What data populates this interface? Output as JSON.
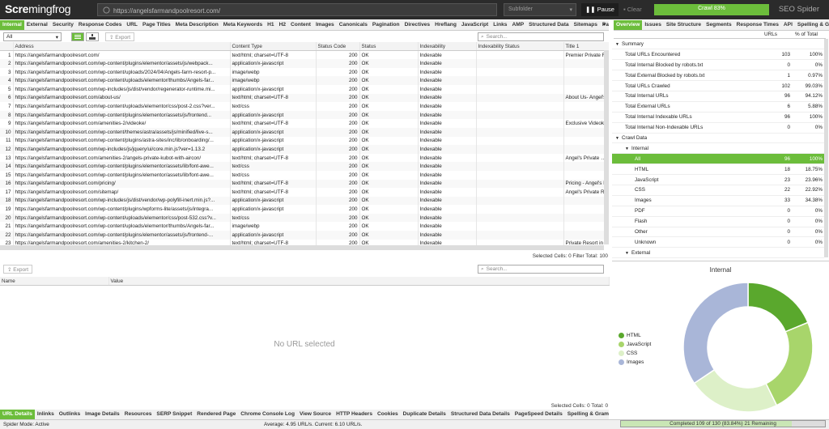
{
  "app": {
    "logo_left": "Scre",
    "logo_frog": "mingfrog",
    "brand": "SEO Spider"
  },
  "toolbar": {
    "url": "https://angelsfarmandpoolresort.com/",
    "subfolder": "Subfolder",
    "pause": "Pause",
    "clear": "Clear",
    "crawl_label": "Crawl 83%",
    "crawl_progress": 0.83
  },
  "main_tabs": [
    "Internal",
    "External",
    "Security",
    "Response Codes",
    "URL",
    "Page Titles",
    "Meta Description",
    "Meta Keywords",
    "H1",
    "H2",
    "Content",
    "Images",
    "Canonicals",
    "Pagination",
    "Directives",
    "Hreflang",
    "JavaScript",
    "Links",
    "AMP",
    "Structured Data",
    "Sitemaps",
    "PageSpee"
  ],
  "filter": {
    "value": "All",
    "export": "Export",
    "search_placeholder": "Search..."
  },
  "grid": {
    "columns": [
      "",
      "Address",
      "Content Type",
      "Status Code",
      "Status",
      "Indexability",
      "Indexability Status",
      "Title 1"
    ],
    "rows": [
      [
        "1",
        "https://angelsfarmandpoolresort.com/",
        "text/html; charset=UTF-8",
        "200",
        "OK",
        "Indexable",
        "",
        "Premier Private R"
      ],
      [
        "2",
        "https://angelsfarmandpoolresort.com/wp-content/plugins/elementor/assets/js/webpack...",
        "application/x-javascript",
        "200",
        "OK",
        "Indexable",
        "",
        ""
      ],
      [
        "3",
        "https://angelsfarmandpoolresort.com/wp-content/uploads/2024/04/Angels-farm-resort-p...",
        "image/webp",
        "200",
        "OK",
        "Indexable",
        "",
        ""
      ],
      [
        "4",
        "https://angelsfarmandpoolresort.com/wp-content/uploads/elementor/thumbs/Angels-far...",
        "image/webp",
        "200",
        "OK",
        "Indexable",
        "",
        ""
      ],
      [
        "5",
        "https://angelsfarmandpoolresort.com/wp-includes/js/dist/vendor/regenerator-runtime.mi...",
        "application/x-javascript",
        "200",
        "OK",
        "Indexable",
        "",
        ""
      ],
      [
        "6",
        "https://angelsfarmandpoolresort.com/about-us/",
        "text/html; charset=UTF-8",
        "200",
        "OK",
        "Indexable",
        "",
        "About Us- Angel's"
      ],
      [
        "7",
        "https://angelsfarmandpoolresort.com/wp-content/uploads/elementor/css/post-2.css?ver...",
        "text/css",
        "200",
        "OK",
        "Indexable",
        "",
        ""
      ],
      [
        "8",
        "https://angelsfarmandpoolresort.com/wp-content/plugins/elementor/assets/js/frontend...",
        "application/x-javascript",
        "200",
        "OK",
        "Indexable",
        "",
        ""
      ],
      [
        "9",
        "https://angelsfarmandpoolresort.com/amenities-2/videoke/",
        "text/html; charset=UTF-8",
        "200",
        "OK",
        "Indexable",
        "",
        "Exclusive Videok"
      ],
      [
        "10",
        "https://angelsfarmandpoolresort.com/wp-content/themes/astra/assets/js/minified/live-s...",
        "application/x-javascript",
        "200",
        "OK",
        "Indexable",
        "",
        ""
      ],
      [
        "11",
        "https://angelsfarmandpoolresort.com/wp-content/plugins/astra-sites/inc/lib/onboarding/...",
        "application/x-javascript",
        "200",
        "OK",
        "Indexable",
        "",
        ""
      ],
      [
        "12",
        "https://angelsfarmandpoolresort.com/wp-includes/js/jquery/ui/core.min.js?ver=1.13.2",
        "application/x-javascript",
        "200",
        "OK",
        "Indexable",
        "",
        ""
      ],
      [
        "13",
        "https://angelsfarmandpoolresort.com/amenities-2/angels-private-kubot-with-aircon/",
        "text/html; charset=UTF-8",
        "200",
        "OK",
        "Indexable",
        "",
        "Angel's Private Ku"
      ],
      [
        "14",
        "https://angelsfarmandpoolresort.com/wp-content/plugins/elementor/assets/lib/font-awe...",
        "text/css",
        "200",
        "OK",
        "Indexable",
        "",
        ""
      ],
      [
        "15",
        "https://angelsfarmandpoolresort.com/wp-content/plugins/elementor/assets/lib/font-awe...",
        "text/css",
        "200",
        "OK",
        "Indexable",
        "",
        ""
      ],
      [
        "16",
        "https://angelsfarmandpoolresort.com/pricing/",
        "text/html; charset=UTF-8",
        "200",
        "OK",
        "Indexable",
        "",
        "Pricing - Angel's P"
      ],
      [
        "17",
        "https://angelsfarmandpoolresort.com/sitemap/",
        "text/html; charset=UTF-8",
        "200",
        "OK",
        "Indexable",
        "",
        "Angel's Private R"
      ],
      [
        "18",
        "https://angelsfarmandpoolresort.com/wp-includes/js/dist/vendor/wp-polyfill-inert.min.js?...",
        "application/x-javascript",
        "200",
        "OK",
        "Indexable",
        "",
        ""
      ],
      [
        "19",
        "https://angelsfarmandpoolresort.com/wp-content/plugins/wpforms-lite/assets/js/integra...",
        "application/x-javascript",
        "200",
        "OK",
        "Indexable",
        "",
        ""
      ],
      [
        "20",
        "https://angelsfarmandpoolresort.com/wp-content/uploads/elementor/css/post-532.css?v...",
        "text/css",
        "200",
        "OK",
        "Indexable",
        "",
        ""
      ],
      [
        "21",
        "https://angelsfarmandpoolresort.com/wp-content/uploads/elementor/thumbs/Angels-far...",
        "image/webp",
        "200",
        "OK",
        "Indexable",
        "",
        ""
      ],
      [
        "22",
        "https://angelsfarmandpoolresort.com/wp-content/plugins/elementor/assets/js/frontend-...",
        "application/x-javascript",
        "200",
        "OK",
        "Indexable",
        "",
        ""
      ],
      [
        "23",
        "https://angelsfarmandpoolresort.com/amenities-2/kitchen-2/",
        "text/html; charset=UTF-8",
        "200",
        "OK",
        "Indexable",
        "",
        "Private Resort in"
      ]
    ],
    "status_text": "Selected Cells:  0  Filter Total:  100"
  },
  "lower": {
    "export": "Export",
    "search_placeholder": "Search...",
    "col_name": "Name",
    "col_value": "Value",
    "empty": "No URL selected",
    "status_text": "Selected Cells:  0  Total:  0"
  },
  "bottom_tabs": [
    "URL Details",
    "Inlinks",
    "Outlinks",
    "Image Details",
    "Resources",
    "SERP Snippet",
    "Rendered Page",
    "Chrome Console Log",
    "View Source",
    "HTTP Headers",
    "Cookies",
    "Duplicate Details",
    "Structured Data Details",
    "PageSpeed Details",
    "Spelling & Grammar Details"
  ],
  "right_tabs": [
    "Overview",
    "Issues",
    "Site Structure",
    "Segments",
    "Response Times",
    "API",
    "Spelling & G"
  ],
  "overview": {
    "col_urls": "URLs",
    "col_pct": "% of Total",
    "rows": [
      {
        "label": "Summary",
        "urls": "",
        "pct": "",
        "level": 0,
        "section": true
      },
      {
        "label": "Total URLs Encountered",
        "urls": "103",
        "pct": "100%",
        "level": 1
      },
      {
        "label": "Total Internal Blocked by robots.txt",
        "urls": "0",
        "pct": "0%",
        "level": 1
      },
      {
        "label": "Total External Blocked by robots.txt",
        "urls": "1",
        "pct": "0.97%",
        "level": 1
      },
      {
        "label": "Total URLs Crawled",
        "urls": "102",
        "pct": "99.03%",
        "level": 1
      },
      {
        "label": "Total Internal URLs",
        "urls": "96",
        "pct": "94.12%",
        "level": 1
      },
      {
        "label": "Total External URLs",
        "urls": "6",
        "pct": "5.88%",
        "level": 1
      },
      {
        "label": "Total Internal Indexable URLs",
        "urls": "96",
        "pct": "100%",
        "level": 1
      },
      {
        "label": "Total Internal Non-Indexable URLs",
        "urls": "0",
        "pct": "0%",
        "level": 1
      },
      {
        "label": "Crawl Data",
        "urls": "",
        "pct": "",
        "level": 0,
        "section": true
      },
      {
        "label": "Internal",
        "urls": "",
        "pct": "",
        "level": 1,
        "section": true
      },
      {
        "label": "All",
        "urls": "96",
        "pct": "100%",
        "level": 2,
        "hl": true
      },
      {
        "label": "HTML",
        "urls": "18",
        "pct": "18.75%",
        "level": 2
      },
      {
        "label": "JavaScript",
        "urls": "23",
        "pct": "23.96%",
        "level": 2
      },
      {
        "label": "CSS",
        "urls": "22",
        "pct": "22.92%",
        "level": 2
      },
      {
        "label": "Images",
        "urls": "33",
        "pct": "34.38%",
        "level": 2
      },
      {
        "label": "PDF",
        "urls": "0",
        "pct": "0%",
        "level": 2
      },
      {
        "label": "Flash",
        "urls": "0",
        "pct": "0%",
        "level": 2
      },
      {
        "label": "Other",
        "urls": "0",
        "pct": "0%",
        "level": 2
      },
      {
        "label": "Unknown",
        "urls": "0",
        "pct": "0%",
        "level": 2
      },
      {
        "label": "External",
        "urls": "",
        "pct": "",
        "level": 1,
        "section": true
      }
    ]
  },
  "chart_data": {
    "type": "pie",
    "title": "Internal",
    "categories": [
      "HTML",
      "JavaScript",
      "CSS",
      "Images"
    ],
    "values": [
      18,
      23,
      22,
      33
    ],
    "colors": [
      "#5aa82d",
      "#a8d56b",
      "#ddf0c8",
      "#a9b6d8"
    ],
    "legend_position": "left"
  },
  "footer": {
    "mode": "Spider Mode: Active",
    "speed": "Average: 4.95 URL/s. Current: 6.10 URL/s.",
    "progress_label": "Completed 109 of 130 (83.84%) 21 Remaining",
    "progress": 0.8384
  }
}
